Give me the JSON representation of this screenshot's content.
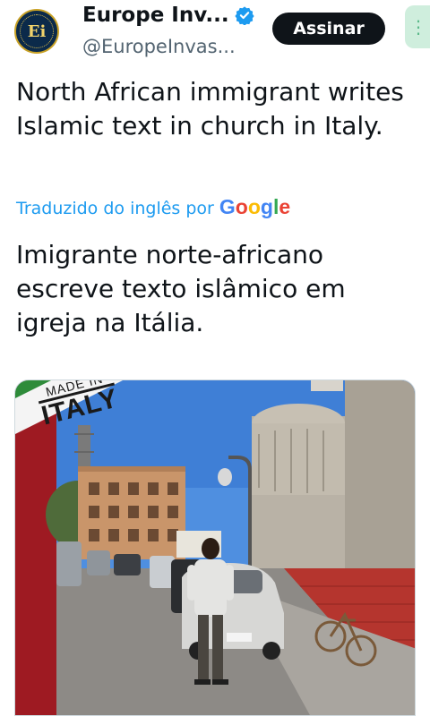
{
  "author": {
    "avatar_text": "Ei",
    "display_name": "Europe Inv...",
    "handle": "@EuropeInvas...",
    "verified_icon": "verified-badge-icon",
    "follow_label": "Assinar"
  },
  "tweet": {
    "original_text": "North African immigrant writes Islamic text in church in Italy.",
    "translation_label": "Traduzido do inglês por",
    "translation_provider": [
      "G",
      "o",
      "o",
      "g",
      "l",
      "e"
    ],
    "translated_text": "Imigrante norte-africano escreve texto islâmico em igreja na Itália."
  },
  "media": {
    "badge_top": "MADE IN",
    "badge_main": "ITALY"
  },
  "colors": {
    "accent": "#1d9bf0",
    "follow_bg": "#0f1419",
    "handle": "#536471"
  }
}
